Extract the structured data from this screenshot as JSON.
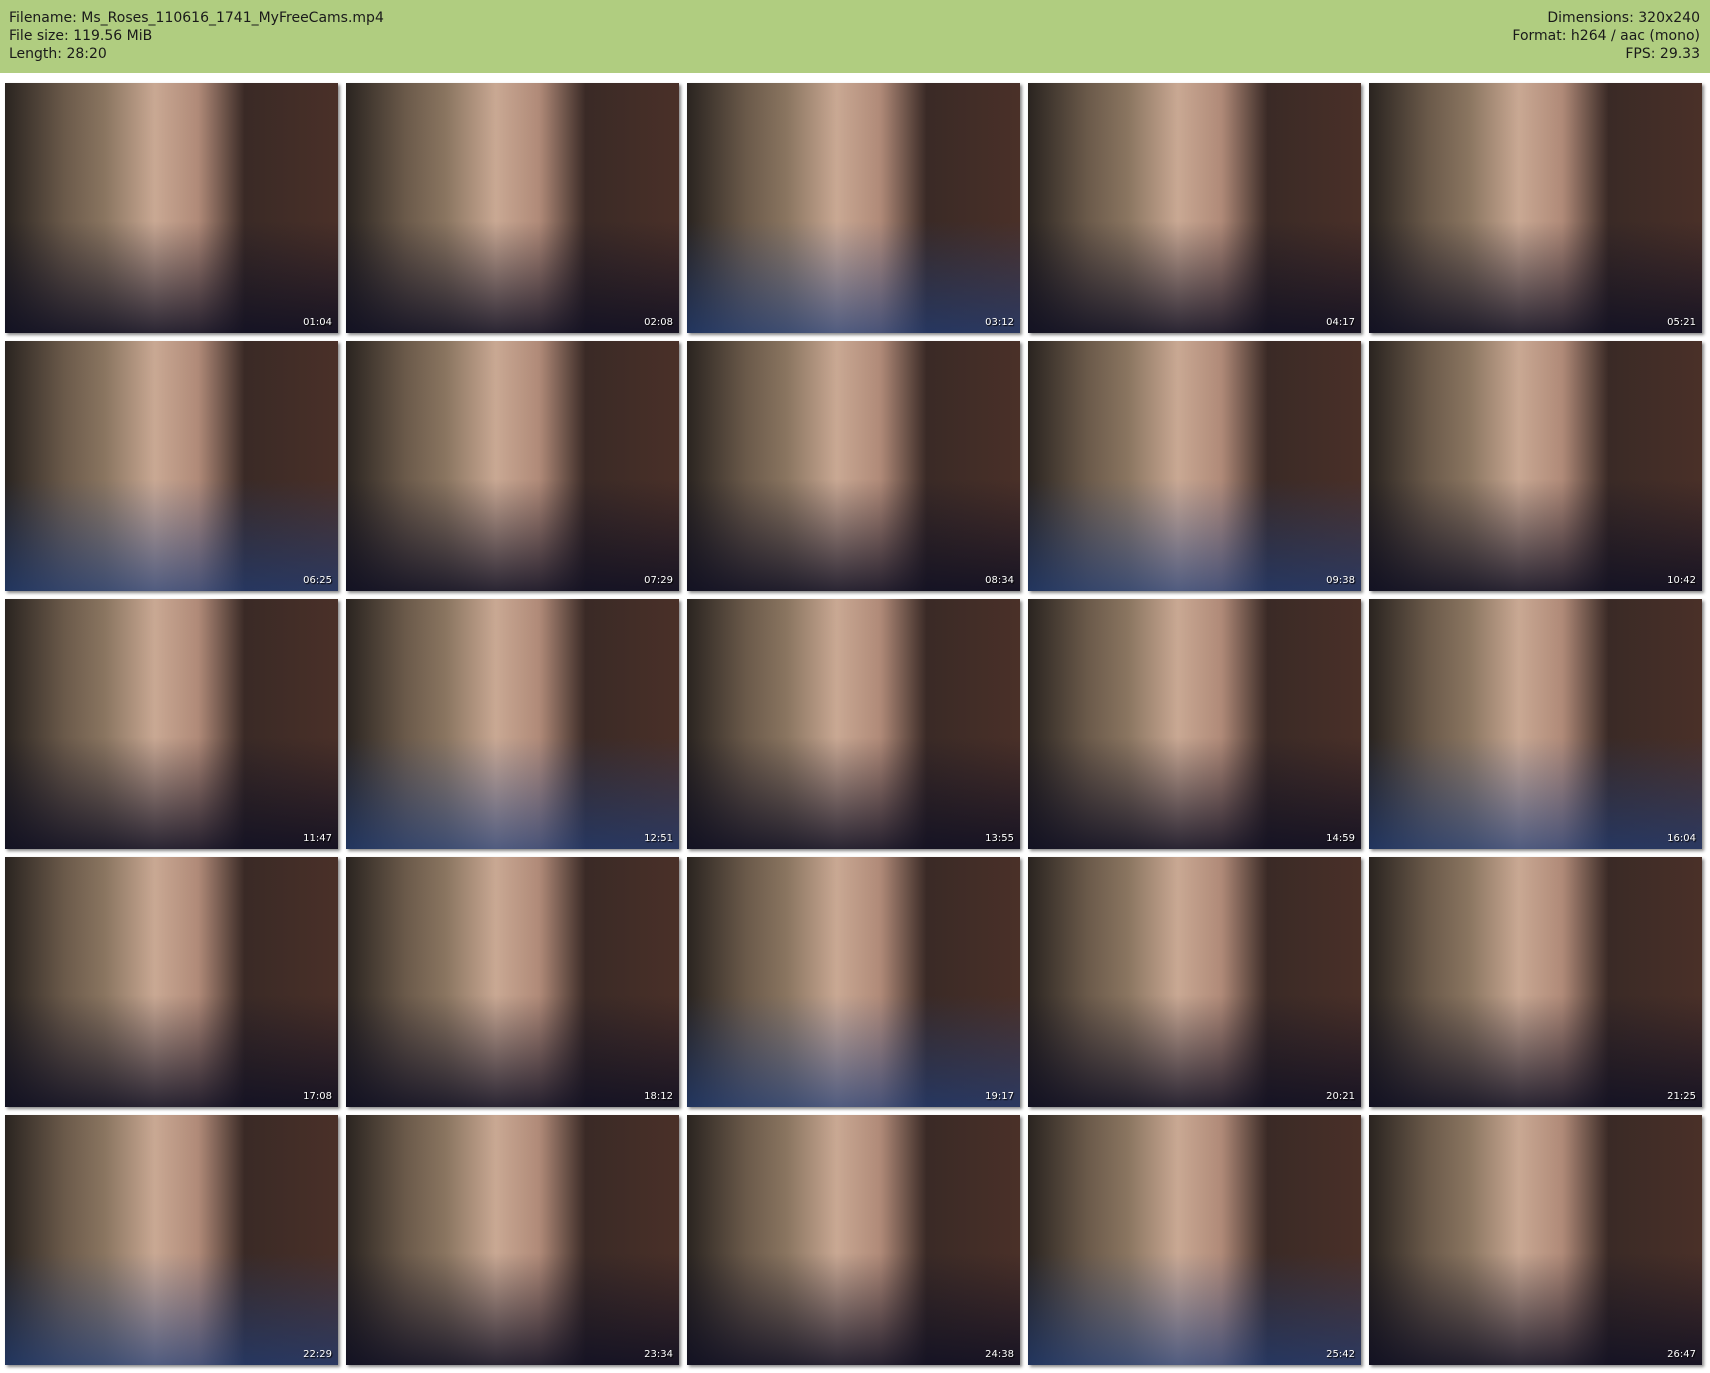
{
  "header": {
    "filename": "Filename: Ms_Roses_110616_1741_MyFreeCams.mp4",
    "filesize": "File size: 119.56 MiB",
    "length": "Length: 28:20",
    "dimensions": "Dimensions: 320x240",
    "format": "Format: h264 / aac (mono)",
    "fps": "FPS: 29.33"
  },
  "thumbnails": [
    "01:04",
    "02:08",
    "03:12",
    "04:17",
    "05:21",
    "06:25",
    "07:29",
    "08:34",
    "09:38",
    "10:42",
    "11:47",
    "12:51",
    "13:55",
    "14:59",
    "16:04",
    "17:08",
    "18:12",
    "19:17",
    "20:21",
    "21:25",
    "22:29",
    "23:34",
    "24:38",
    "25:42",
    "26:47"
  ],
  "colors": {
    "header_bg": "#b0cd80"
  }
}
